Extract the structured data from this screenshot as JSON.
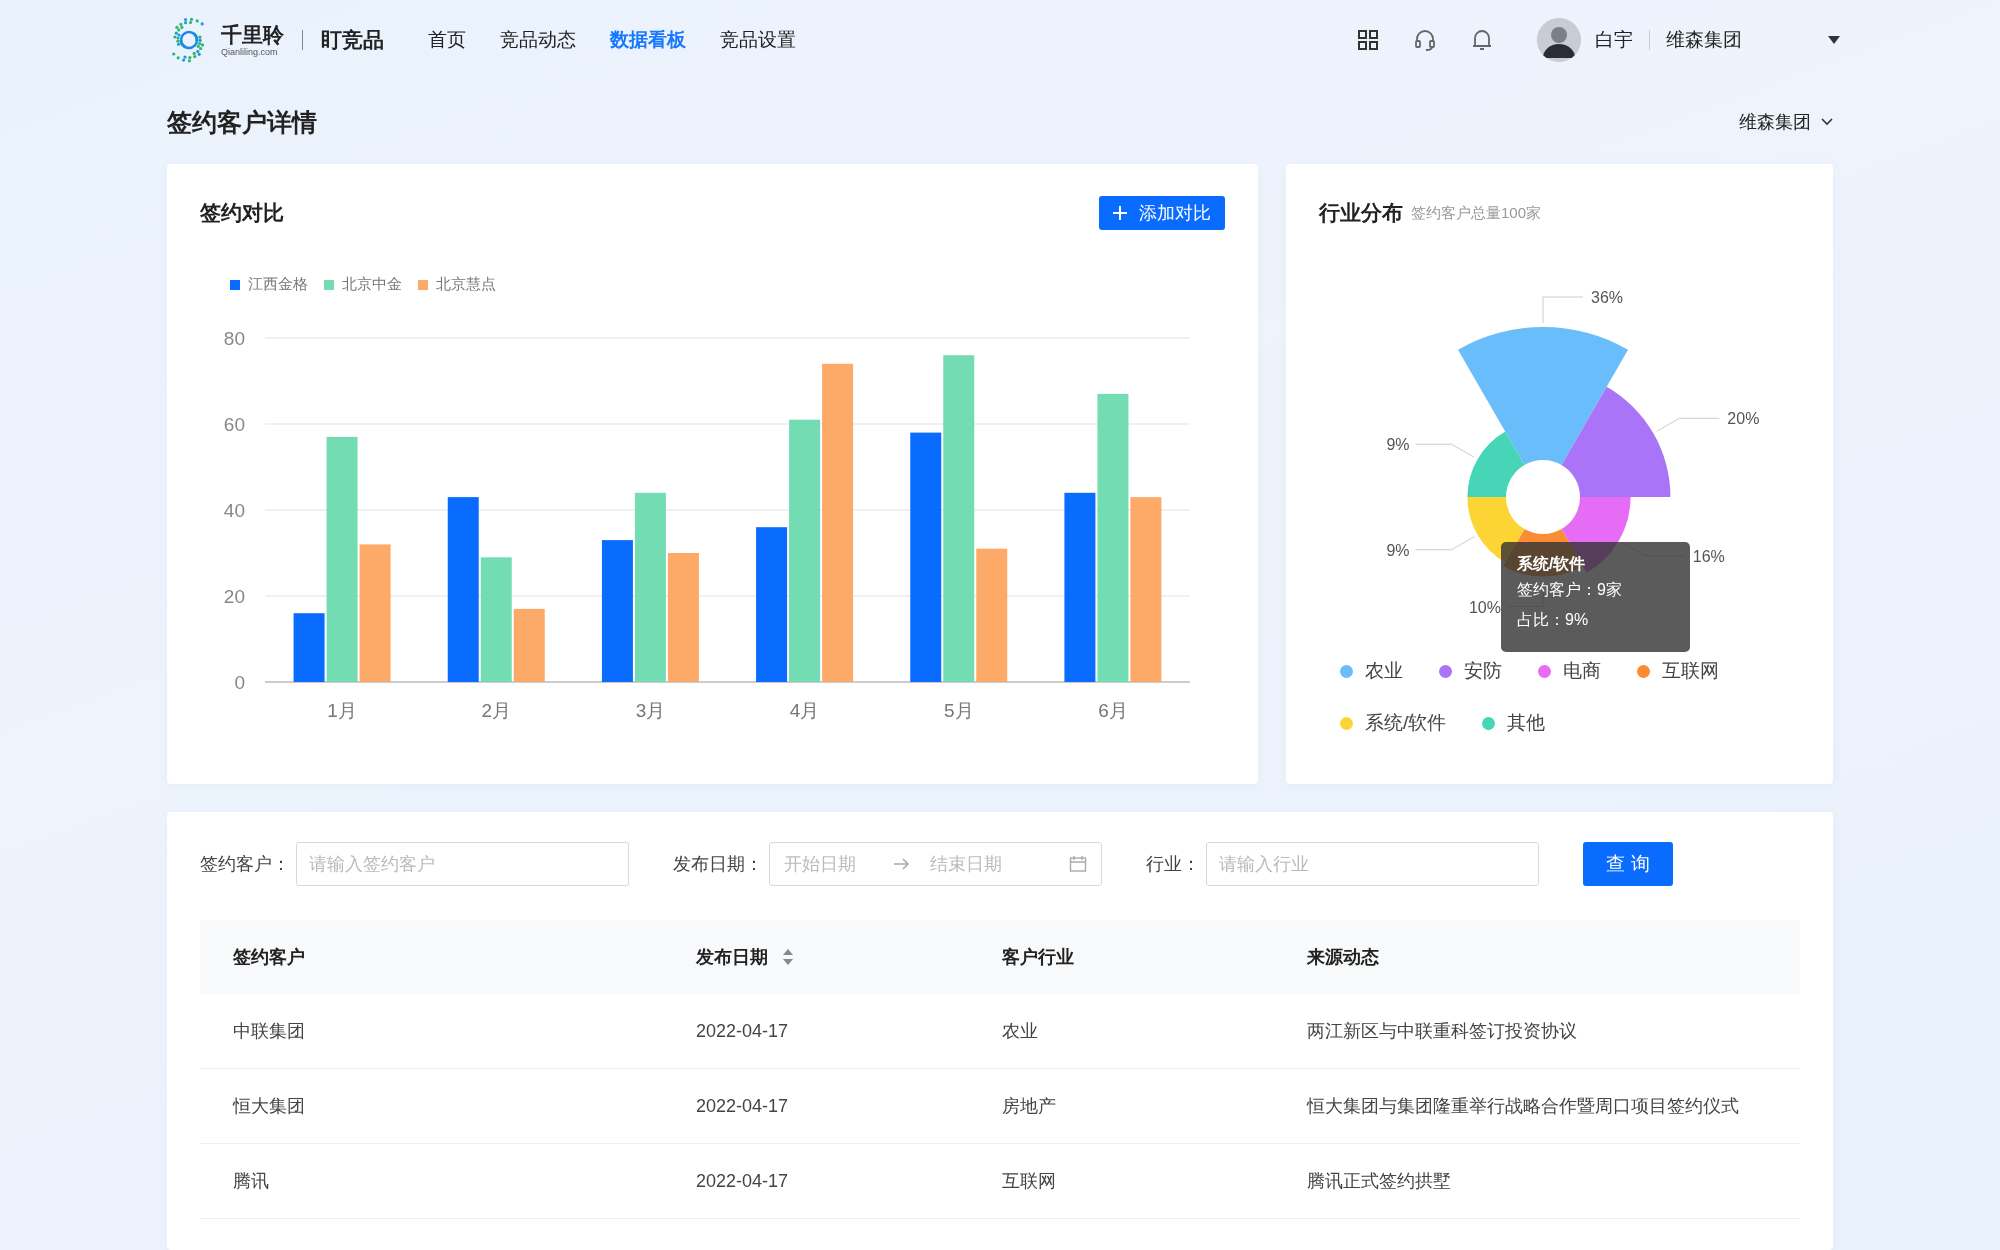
{
  "header": {
    "brand": "千里聆",
    "brand_sub": "Qianliling.com",
    "product": "盯竞品",
    "nav": [
      {
        "label": "首页",
        "selected": false
      },
      {
        "label": "竞品动态",
        "selected": false
      },
      {
        "label": "数据看板",
        "selected": true
      },
      {
        "label": "竞品设置",
        "selected": false
      }
    ],
    "user": {
      "name": "白宇",
      "org": "维森集团"
    }
  },
  "page": {
    "title": "签约客户详情",
    "org_select": "维森集团"
  },
  "bar_card": {
    "title": "签约对比",
    "button": "添加对比",
    "chart_data": {
      "type": "bar",
      "categories": [
        "1月",
        "2月",
        "3月",
        "4月",
        "5月",
        "6月"
      ],
      "ylim": [
        0,
        80
      ],
      "yticks": [
        0,
        20,
        40,
        60,
        80
      ],
      "grid": true,
      "legend": true,
      "series": [
        {
          "name": "江西金格",
          "color": "#0a6cff",
          "values": [
            16,
            43,
            33,
            36,
            58,
            44
          ]
        },
        {
          "name": "北京中金",
          "color": "#74dcb3",
          "values": [
            57,
            29,
            44,
            61,
            76,
            67
          ]
        },
        {
          "name": "北京慧点",
          "color": "#fdaa68",
          "values": [
            32,
            17,
            30,
            74,
            31,
            43
          ]
        }
      ]
    }
  },
  "pie_card": {
    "title": "行业分布",
    "subtitle": "签约客户总量100家",
    "rose": [
      {
        "label": "36%",
        "color": "#69bdfb"
      },
      {
        "label": "20%",
        "color": "#a974f8"
      },
      {
        "label": "16%",
        "color": "#e66cf6"
      },
      {
        "label": "10%",
        "color": "#fa8c35"
      },
      {
        "label": "9%",
        "color": "#fcd535"
      },
      {
        "label": "9%",
        "color": "#46d6b7"
      }
    ],
    "tooltip": {
      "title": "系统/软件",
      "lines": [
        "签约客户：9家",
        "占比：9%"
      ]
    },
    "legend": [
      {
        "label": "农业",
        "color": "#69bdfb"
      },
      {
        "label": "安防",
        "color": "#a974f8"
      },
      {
        "label": "电商",
        "color": "#e66cf6"
      },
      {
        "label": "互联网",
        "color": "#fa8c35"
      },
      {
        "label": "系统/软件",
        "color": "#fcd535"
      },
      {
        "label": "其他",
        "color": "#46d6b7"
      }
    ]
  },
  "filters": [
    {
      "kind": "text",
      "label": "签约客户：",
      "placeholder": "请输入签约客户"
    },
    {
      "kind": "daterange",
      "label": "发布日期：",
      "start_placeholder": "开始日期",
      "end_placeholder": "结束日期"
    },
    {
      "kind": "text",
      "label": "行业：",
      "placeholder": "请输入行业"
    }
  ],
  "query_button": "查 询",
  "table": {
    "columns": [
      {
        "label": "签约客户",
        "sortable": false
      },
      {
        "label": "发布日期",
        "sortable": true
      },
      {
        "label": "客户行业",
        "sortable": false
      },
      {
        "label": "来源动态",
        "sortable": false
      }
    ],
    "rows": [
      [
        "中联集团",
        "2022-04-17",
        "农业",
        "两江新区与中联重科签订投资协议"
      ],
      [
        "恒大集团",
        "2022-04-17",
        "房地产",
        "恒大集团与集团隆重举行战略合作暨周口项目签约仪式"
      ],
      [
        "腾讯",
        "2022-04-17",
        "互联网",
        "腾讯正式签约拱墅"
      ]
    ]
  }
}
